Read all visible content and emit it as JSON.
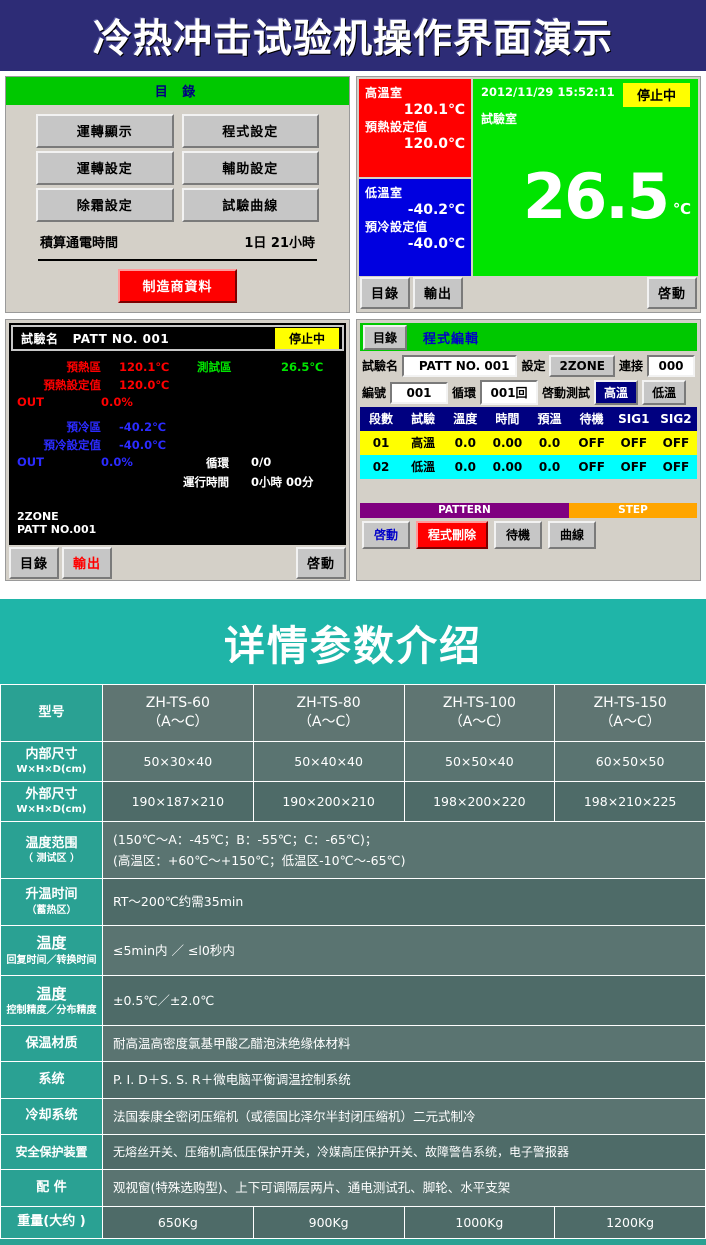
{
  "banner": {
    "title": "冷热冲击试验机操作界面演示"
  },
  "menu_panel": {
    "title": "目  錄",
    "buttons": [
      "運轉顯示",
      "程式設定",
      "運轉設定",
      "輔助設定",
      "除霜設定",
      "試驗曲線"
    ],
    "hours_label": "積算通電時間",
    "hours_value": "1日 21小時",
    "maker_button": "制造商資料"
  },
  "temp_panel": {
    "hot": {
      "label": "高溫室",
      "value": "120.1℃",
      "set_label": "預熱設定值",
      "set_value": "120.0℃",
      "color": "#ff0000"
    },
    "cold": {
      "label": "低溫室",
      "value": "-40.2℃",
      "set_label": "預冷設定值",
      "set_value": "-40.0℃",
      "color": "#0000e0"
    },
    "datetime": "2012/11/29 15:52:11",
    "status": "停止中",
    "room_label": "試驗室",
    "big_value": "26.5",
    "big_unit": "℃",
    "buttons": {
      "menu": "目錄",
      "output": "輸出",
      "start": "啓動"
    }
  },
  "run_panel": {
    "test_name_label": "試驗名",
    "test_name_value": "PATT NO. 001",
    "status": "停止中",
    "rows": [
      {
        "label": "預熱區",
        "value": "120.1℃",
        "label2": "測試區",
        "value2": "26.5℃"
      },
      {
        "label": "預熱設定值",
        "value": "120.0℃"
      },
      {
        "label": "OUT",
        "value": "0.0%"
      },
      {
        "label": "預冷區",
        "value": "-40.2℃"
      },
      {
        "label": "預冷設定值",
        "value": "-40.0℃"
      },
      {
        "label": "OUT",
        "value": "0.0%"
      }
    ],
    "cycle_label": "循環",
    "cycle_value": "0/0",
    "runtime_label": "運行時間",
    "runtime_value": "0小時 00分",
    "zone": "2ZONE",
    "patt": "PATT NO.001",
    "buttons": {
      "menu": "目錄",
      "output": "輸出",
      "start": "啓動"
    }
  },
  "prog_panel": {
    "menu_button": "目錄",
    "title": "程式編輯",
    "name_label": "試驗名",
    "name_value": "PATT NO. 001",
    "set_label": "設定",
    "set_value": "2ZONE",
    "link_label": "連接",
    "link_value": "000",
    "no_label": "編號",
    "no_value": "001",
    "cycle_label": "循環",
    "cycle_value": "001回",
    "starttest_label": "啓動測試",
    "hot_button": "高溫",
    "cold_button": "低溫",
    "columns": [
      "段數",
      "試驗",
      "溫度",
      "時間",
      "預溫",
      "待機",
      "SIG1",
      "SIG2"
    ],
    "rows": [
      [
        "01",
        "高溫",
        "0.0",
        "0.00",
        "0.0",
        "OFF",
        "OFF",
        "OFF"
      ],
      [
        "02",
        "低溫",
        "0.0",
        "0.00",
        "0.0",
        "OFF",
        "OFF",
        "OFF"
      ]
    ],
    "pattern_label": "PATTERN",
    "step_label": "STEP",
    "footer_buttons": [
      "啓動",
      "程式刪除",
      "待機",
      "曲線"
    ]
  },
  "spec": {
    "heading": "详情参数介绍",
    "header_row": {
      "label": "型号",
      "models": [
        {
          "name": "ZH-TS-60",
          "variant": "（A～C）"
        },
        {
          "name": "ZH-TS-80",
          "variant": "（A～C）"
        },
        {
          "name": "ZH-TS-100",
          "variant": "（A～C）"
        },
        {
          "name": "ZH-TS-150",
          "variant": "（A～C）"
        }
      ]
    },
    "rows": [
      {
        "label_main": "内部尺寸",
        "label_sub": "W×H×D(cm)",
        "type": "cols",
        "values": [
          "50×30×40",
          "50×40×40",
          "50×50×40",
          "60×50×50"
        ]
      },
      {
        "label_main": "外部尺寸",
        "label_sub": "W×H×D(cm)",
        "type": "cols",
        "values": [
          "190×187×210",
          "190×200×210",
          "198×200×220",
          "198×210×225"
        ]
      },
      {
        "label_main": "温度范围",
        "label_sub": "（ 测试区 ）",
        "type": "lines",
        "lines": [
          "(150℃～A：-45℃；B：-55℃；C：-65℃)；",
          "(高温区：+60℃～+150℃；低温区-10℃～-65℃)"
        ]
      },
      {
        "label_main": "升温时间",
        "label_sub": "（蓄热区）",
        "type": "text",
        "text": "RT～200℃约需35min"
      },
      {
        "label_big": "温度",
        "label_sub": "回复时间／转换时间",
        "type": "text",
        "text": "≤5min内 ／ ≤l0秒内"
      },
      {
        "label_big": "温度",
        "label_sub": "控制精度／分布精度",
        "type": "text",
        "text": "±0.5℃／±2.0℃"
      },
      {
        "label_main": "保温材质",
        "type": "text",
        "text": "耐高温高密度氯基甲酸乙醋泡沫绝缘体材料"
      },
      {
        "label_main": "系统",
        "type": "text",
        "text": "P. I. D＋S. S. R＋微电脑平衡调温控制系统"
      },
      {
        "label_main": "冷却系统",
        "type": "text",
        "text": "法国泰康全密闭压缩机（或德国比泽尔半封闭压缩机）二元式制冷"
      },
      {
        "label_main": "安全保护装置",
        "type": "text",
        "text": "无熔丝开关、压缩机高低压保护开关，冷媒高压保护开关、故障警告系统，电子警报器"
      },
      {
        "label_main": "配 件",
        "type": "text",
        "text": "观视窗(特殊选购型)、上下可调隔层两片、通电测试孔、脚轮、水平支架"
      },
      {
        "label_main": "重量(大约 )",
        "type": "cols",
        "values": [
          "650Kg",
          "900Kg",
          "1000Kg",
          "1200Kg"
        ]
      }
    ]
  }
}
